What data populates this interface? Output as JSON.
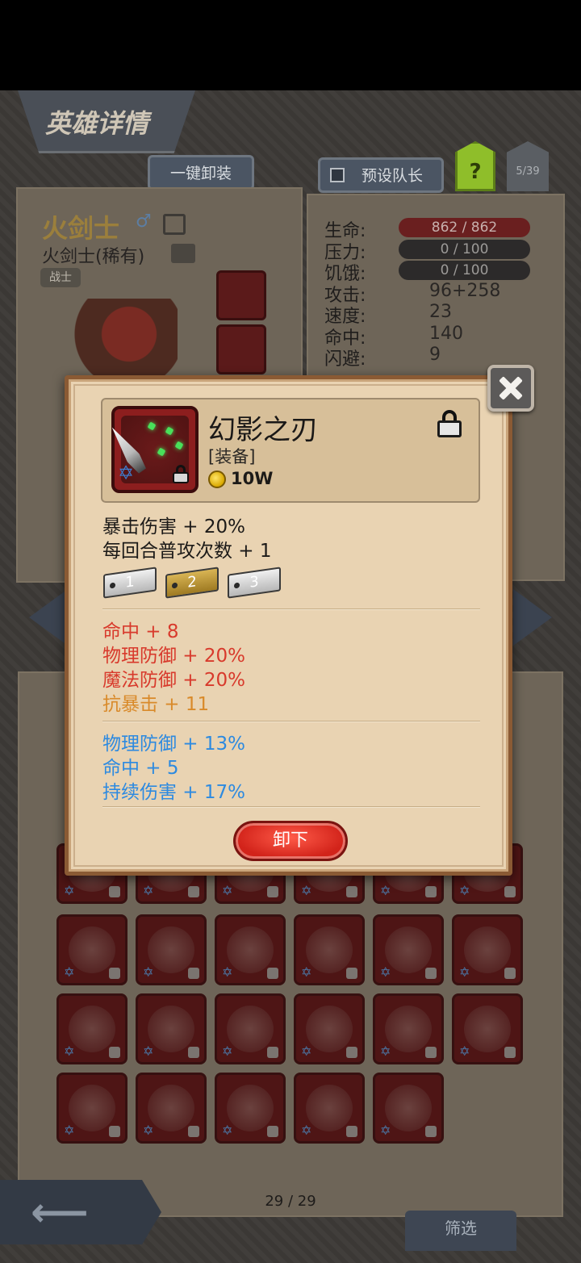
{
  "header": {
    "title": "英雄详情"
  },
  "top_buttons": {
    "unequip_all": "一键卸装",
    "preset_leader": "预设队长",
    "help": "?",
    "team_count": "5/39"
  },
  "hero": {
    "name": "火剑士",
    "class_rarity": "火剑士(稀有)",
    "tag": "战士"
  },
  "stats": [
    {
      "label": "生命:",
      "value": "862 / 862",
      "kind": "bar-hp"
    },
    {
      "label": "压力:",
      "value": "0 / 100",
      "kind": "bar"
    },
    {
      "label": "饥饿:",
      "value": "0 / 100",
      "kind": "bar"
    },
    {
      "label": "攻击:",
      "value": "96+258",
      "kind": "text"
    },
    {
      "label": "速度:",
      "value": "23",
      "kind": "text"
    },
    {
      "label": "命中:",
      "value": "140",
      "kind": "text"
    },
    {
      "label": "闪避:",
      "value": "9",
      "kind": "text"
    }
  ],
  "item_detail": {
    "name": "幻影之刃",
    "type": "[装备]",
    "price": "10W",
    "main_stats": [
      "暴击伤害 + 20%",
      "每回合普攻次数 + 1"
    ],
    "tiers": [
      "1",
      "2",
      "3"
    ],
    "selected_tier": "2",
    "red_stats": [
      "命中 + 8",
      "物理防御 + 20%",
      "魔法防御 + 20%"
    ],
    "orange_stats": [
      "抗暴击 + 11"
    ],
    "blue_stats": [
      "物理防御 + 13%",
      "命中 + 5",
      "持续伤害 + 17%"
    ],
    "unequip_label": "卸下"
  },
  "inventory": {
    "page": "29 / 29",
    "filter_label": "筛选"
  },
  "colors": {
    "red_stat": "#d83a2c",
    "orange_stat": "#d98a2a",
    "blue_stat": "#2d8ae0",
    "modal_bg": "#e9d3b2",
    "button_red": "#d2231a"
  },
  "icons": [
    "close-icon",
    "lock-icon",
    "star-of-david-icon",
    "coin-icon",
    "back-arrow-icon",
    "edit-icon",
    "gender-icon"
  ]
}
